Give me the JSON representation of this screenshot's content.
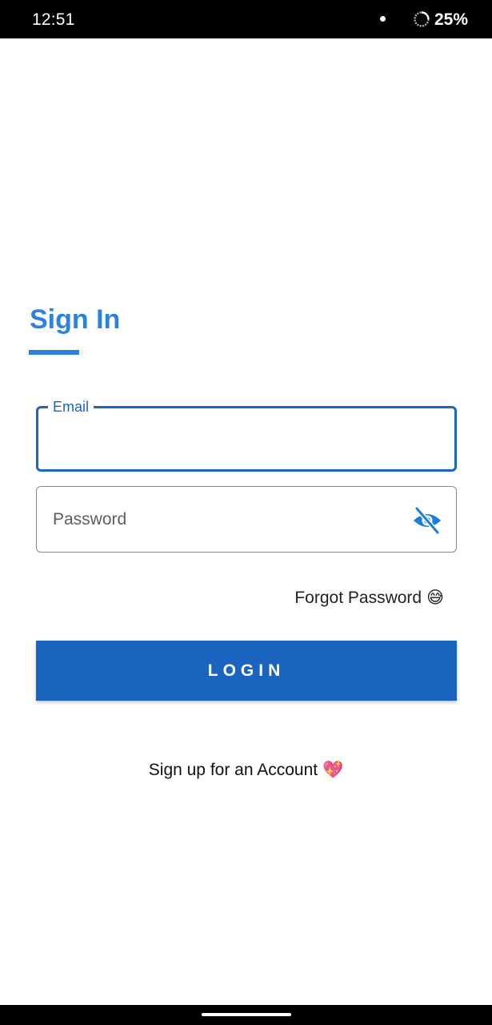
{
  "status_bar": {
    "time": "12:51",
    "battery_percent": "25%",
    "battery_icon": "battery-saver-ring-icon",
    "notification_icon": "dot-icon"
  },
  "screen": {
    "title": "Sign In",
    "accent_color": "#2b83dc"
  },
  "form": {
    "email": {
      "label": "Email",
      "value": "",
      "state": "focused"
    },
    "password": {
      "placeholder": "Password",
      "value": "",
      "toggle_icon": "eye-off-icon"
    },
    "forgot_password": {
      "label": "Forgot Password",
      "emoji": "😅"
    },
    "login_button": {
      "label": "LOGIN",
      "color": "#1a64c0"
    },
    "signup": {
      "label": "Sign up for an Account",
      "emoji": "💖"
    }
  },
  "nav_bar": {
    "home_indicator": "home-indicator"
  }
}
